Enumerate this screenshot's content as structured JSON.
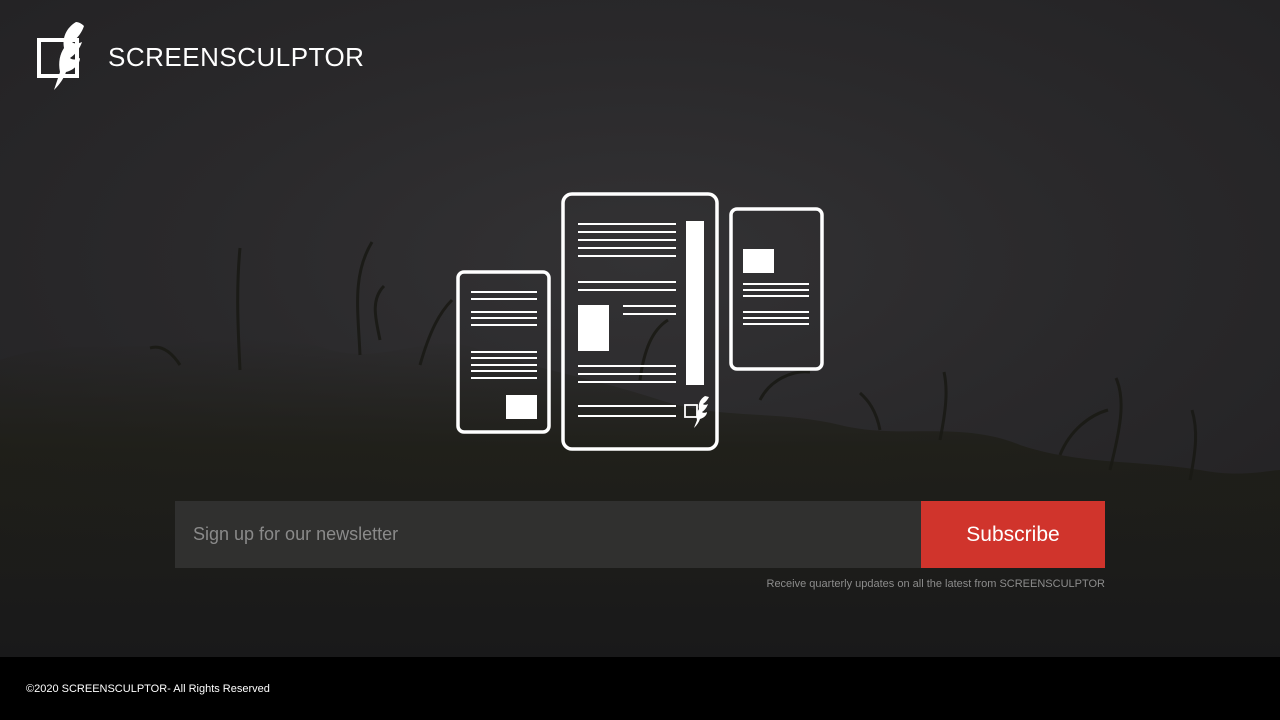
{
  "brand": {
    "name": "SCREENSCULPTOR",
    "logo_icon": "feather-quill-logo-icon"
  },
  "hero": {
    "illustration_icon": "responsive-devices-icon"
  },
  "newsletter": {
    "placeholder": "Sign up for our newsletter",
    "value": "",
    "subscribe_label": "Subscribe",
    "note": "Receive quarterly updates on all the latest from SCREENSCULPTOR"
  },
  "footer": {
    "copyright": "©2020 SCREENSCULPTOR- All Rights Reserved"
  },
  "colors": {
    "accent": "#d0342c",
    "footer_bg": "#000000",
    "hero_bg": "#2a292b",
    "input_bg": "#343434"
  }
}
